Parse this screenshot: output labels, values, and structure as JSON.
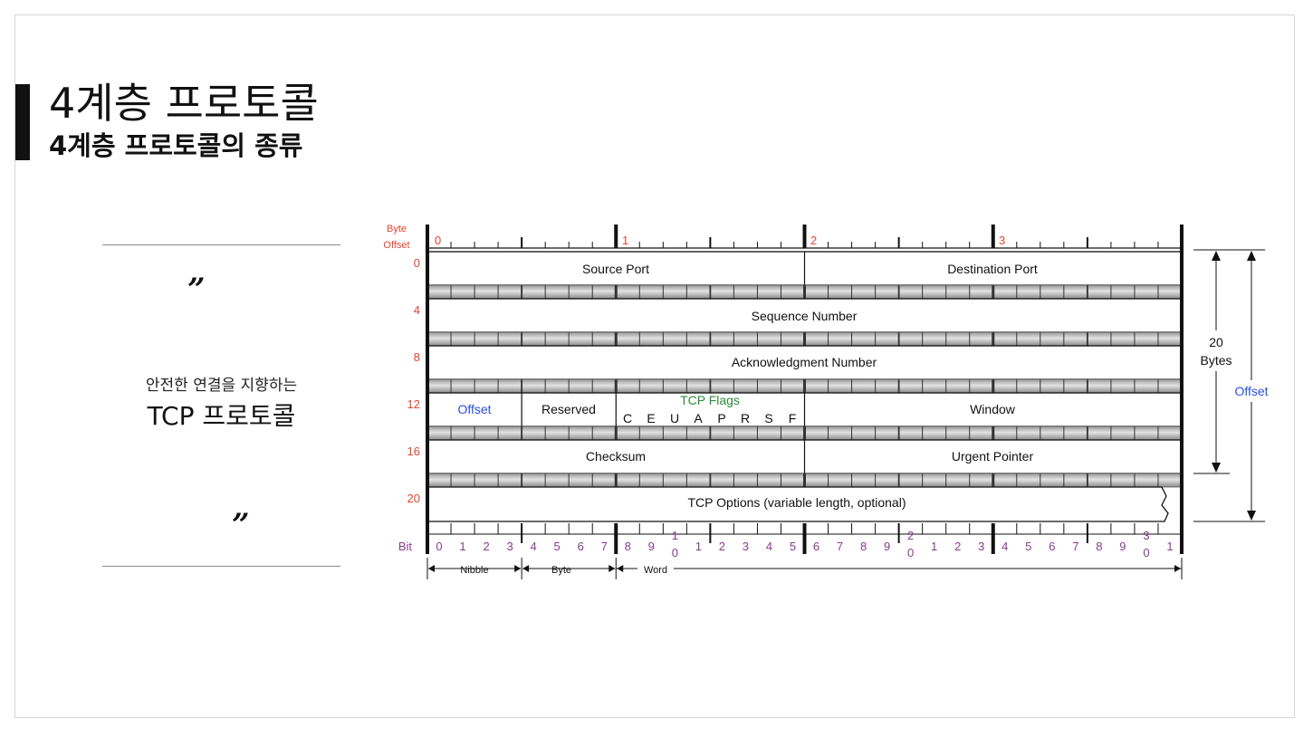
{
  "slide": {
    "title": "4계층 프로토콜",
    "subtitle": "4계층 프로토콜의 종류",
    "quote_line1": "안전한 연결을 지향하는",
    "quote_line2": "TCP 프로토콜",
    "quote_mark": "”"
  },
  "colors": {
    "red": "#e8432f",
    "blue": "#2a50e0",
    "green": "#2e8b3a",
    "purple": "#8a3b8f"
  },
  "diagram": {
    "byte_offset_label": [
      "Byte",
      "Offset"
    ],
    "bytes": [
      "0",
      "1",
      "2",
      "3"
    ],
    "row_offsets": [
      "0",
      "4",
      "8",
      "12",
      "16",
      "20"
    ],
    "source_port": "Source Port",
    "destination_port": "Destination Port",
    "sequence_number": "Sequence Number",
    "acknowledgment_number": "Acknowledgment Number",
    "offset": "Offset",
    "reserved": "Reserved",
    "tcp_flags": "TCP Flags",
    "flags": [
      "C",
      "E",
      "U",
      "A",
      "P",
      "R",
      "S",
      "F"
    ],
    "window": "Window",
    "checksum": "Checksum",
    "urgent_pointer": "Urgent Pointer",
    "tcp_options": "TCP Options (variable length, optional)",
    "bit_label": "Bit",
    "bit_numbers": [
      "0",
      "1",
      "2",
      "3",
      "4",
      "5",
      "6",
      "7",
      "8",
      "9",
      "10",
      "1",
      "2",
      "3",
      "4",
      "5",
      "6",
      "7",
      "8",
      "9",
      "20",
      "1",
      "2",
      "3",
      "4",
      "5",
      "6",
      "7",
      "8",
      "9",
      "30",
      "1"
    ],
    "nibble": "Nibble",
    "byte": "Byte",
    "word": "Word",
    "twenty": "20",
    "bytes_label": "Bytes",
    "offset_side": "Offset"
  }
}
